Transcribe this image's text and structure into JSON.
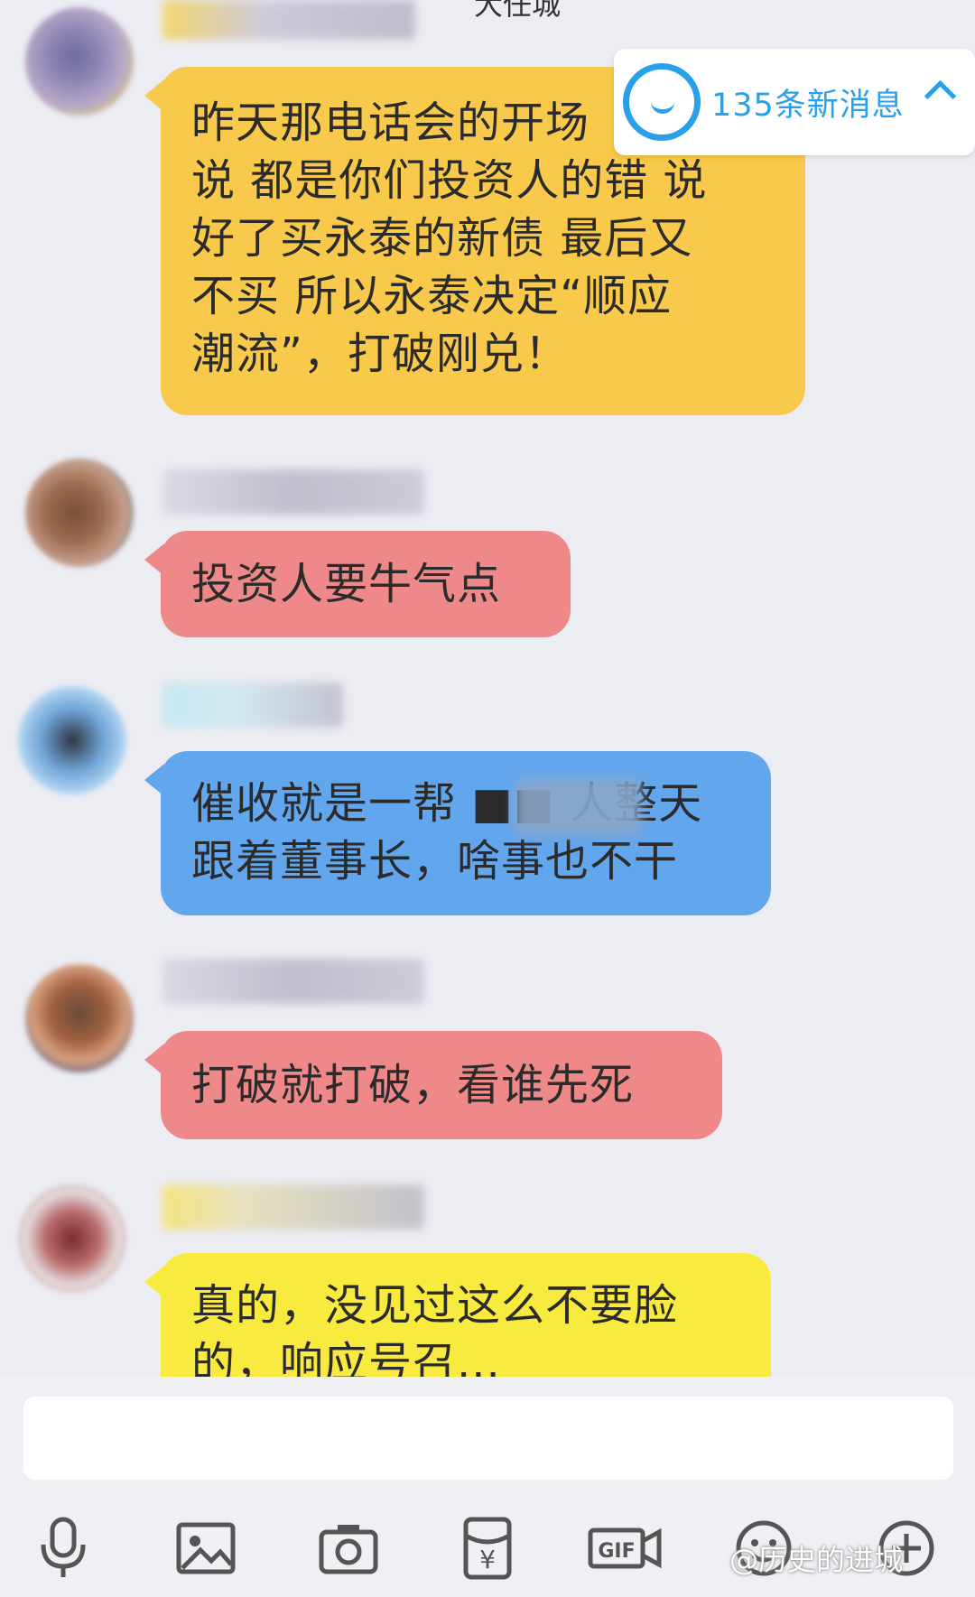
{
  "header": {
    "title_fragment": "大任城"
  },
  "messages": [
    {
      "lines": [
        "昨天那电话会的开场",
        "说 都是你们投资人的错 说",
        "好了买永泰的新债 最后又",
        "不买 所以永泰决定“顺应",
        "潮流”，打破刚兑！"
      ],
      "color": "#f8c94a"
    },
    {
      "lines": [
        "投资人要牛气点"
      ],
      "color": "#ef8989"
    },
    {
      "lines": [
        "催收就是一帮 ■■ 人整天",
        "跟着董事长，啥事也不干"
      ],
      "color": "#62a6ee"
    },
    {
      "lines": [
        "打破就打破，看谁先死"
      ],
      "color": "#ef8989"
    },
    {
      "lines": [
        "真的，没见过这么不要脸",
        "的，响应号召..."
      ],
      "color": "#f9ea3f"
    }
  ],
  "new_messages": {
    "label": "135条新消息",
    "icon": "chat-bubble-icon"
  },
  "toolbar": {
    "icons": [
      "microphone-icon",
      "image-icon",
      "camera-icon",
      "red-packet-icon",
      "gif-icon",
      "emoji-icon",
      "plus-icon"
    ],
    "red_packet_symbol": "¥",
    "gif_label": "GIF"
  },
  "watermark": "@历史的进城"
}
